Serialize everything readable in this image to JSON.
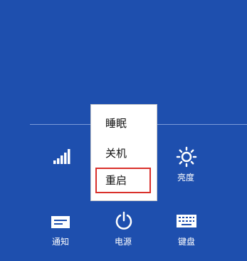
{
  "power_menu": {
    "items": [
      {
        "label": "睡眠"
      },
      {
        "label": "关机"
      },
      {
        "label": "重启"
      }
    ],
    "selected": "重启",
    "highlight_color": "#d9302b"
  },
  "settings": {
    "wifi_icon": "signal-icon",
    "brightness_label": "亮度",
    "notifications_label": "通知",
    "power_label": "电源",
    "keyboard_label": "键盘"
  },
  "colors": {
    "background": "#1e4fae",
    "text": "#ffffff"
  }
}
